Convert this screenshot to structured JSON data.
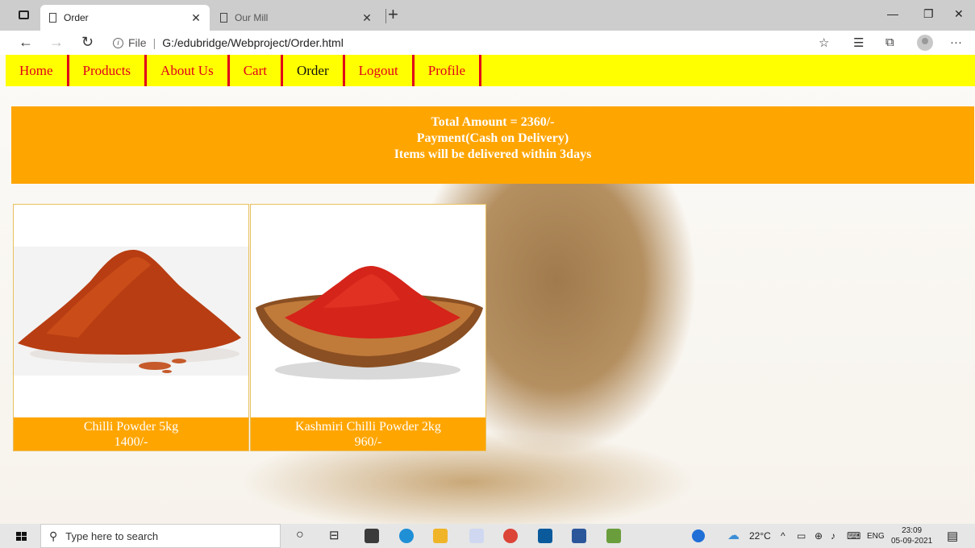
{
  "browser": {
    "tabs": [
      {
        "title": "Order",
        "active": true
      },
      {
        "title": "Our Mill",
        "active": false
      }
    ],
    "address": {
      "scheme_label": "File",
      "url": "G:/edubridge/Webproject/Order.html"
    }
  },
  "navbar": {
    "items": [
      "Home",
      "Products",
      "About Us",
      "Cart",
      "Order",
      "Logout",
      "Profile"
    ],
    "current": "Order"
  },
  "summary": {
    "total": "Total Amount = 2360/-",
    "payment": "Payment(Cash on Delivery)",
    "delivery": "Items will be delivered within 3days"
  },
  "products": [
    {
      "name": "Chilli Powder 5kg",
      "price": "1400/-"
    },
    {
      "name": "Kashmiri Chilli Powder 2kg",
      "price": "960/-"
    }
  ],
  "taskbar": {
    "search_placeholder": "Type here to search",
    "temperature": "22°C",
    "language": "ENG",
    "time": "23:09",
    "date": "05-09-2021"
  },
  "colors": {
    "navbar_bg": "#ffff00",
    "nav_link": "#e0001b",
    "accent_orange": "#ffa500"
  }
}
